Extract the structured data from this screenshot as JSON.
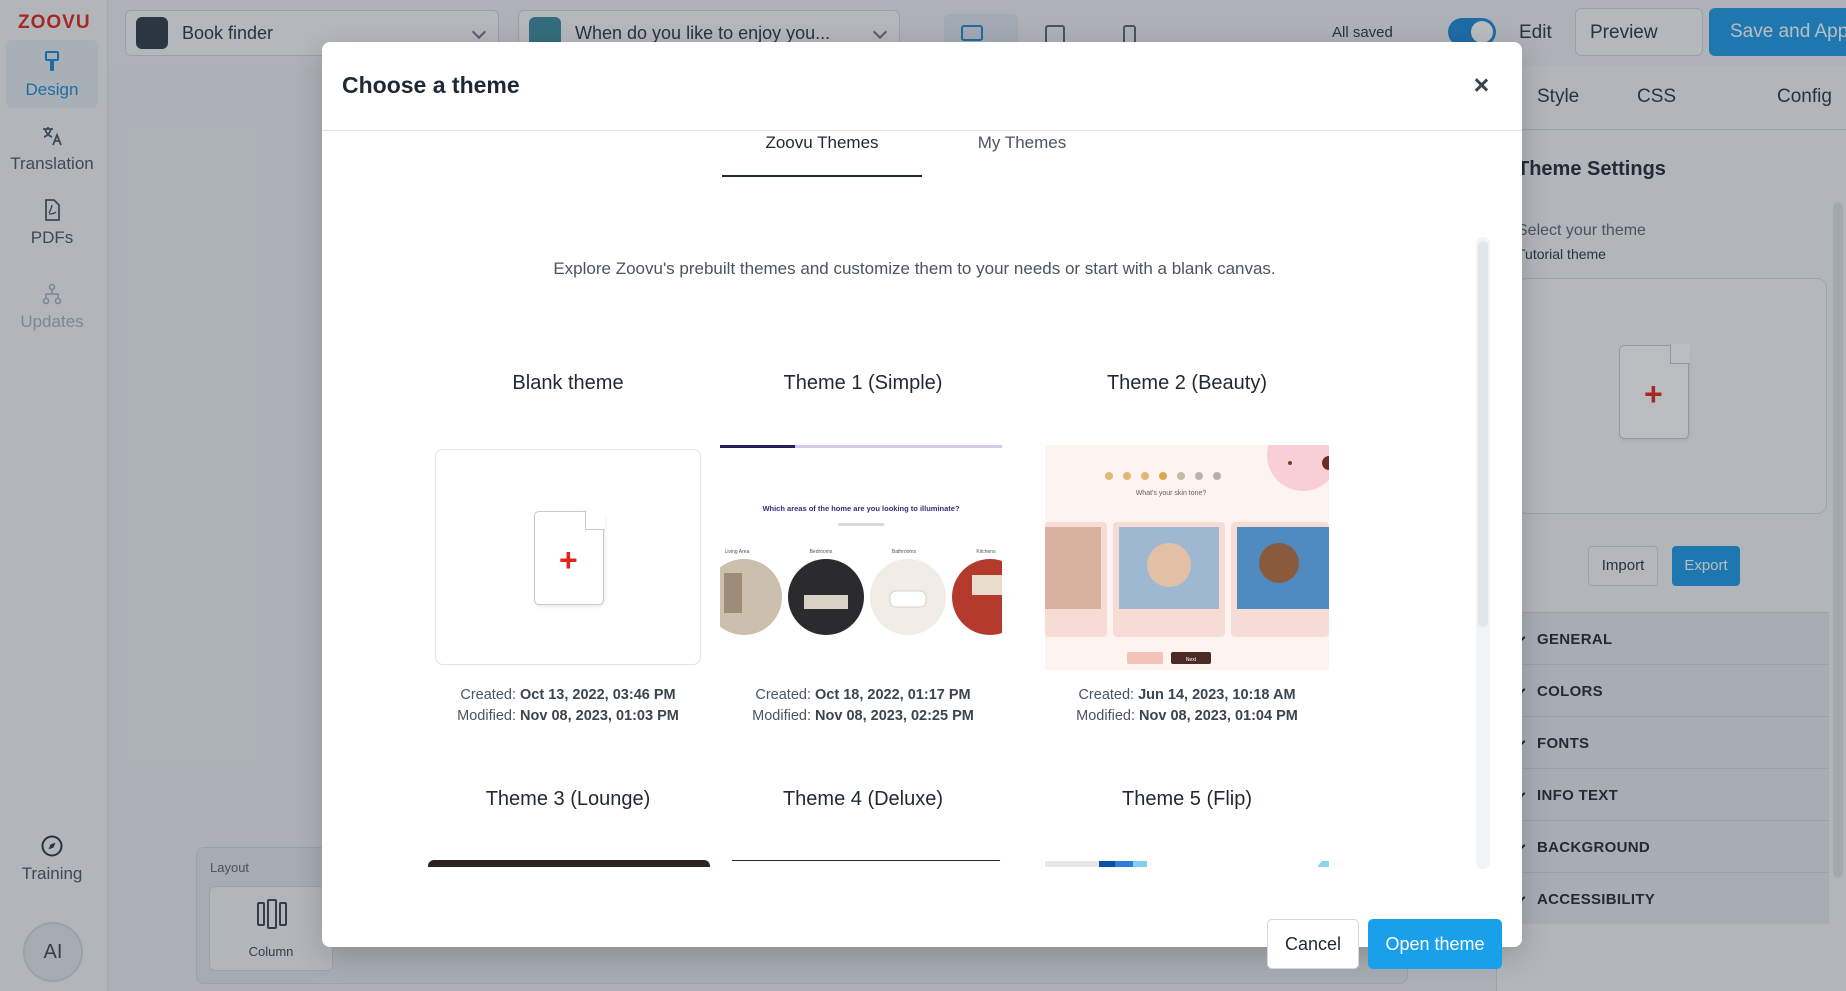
{
  "app": {
    "logo": "ZOOVU",
    "brand_color": "#e1251b",
    "accent_color": "#1a9be6"
  },
  "sidebar": {
    "items": [
      {
        "label": "Design",
        "icon": "paint-brush-icon"
      },
      {
        "label": "Translation",
        "icon": "translate-icon"
      },
      {
        "label": "PDFs",
        "icon": "pdf-icon"
      },
      {
        "label": "Updates",
        "icon": "flow-icon"
      },
      {
        "label": "Training",
        "icon": "compass-icon"
      }
    ],
    "ai_badge": "AI"
  },
  "topbar": {
    "project_select": "Book finder",
    "question_select": "When do you like to enjoy you...",
    "all_saved": "All saved",
    "edit_label": "Edit",
    "preview_label": "Preview",
    "save_apply_label": "Save and Apply"
  },
  "canvas": {
    "layout_label": "Layout",
    "layout_column_label": "Column"
  },
  "right_panel": {
    "tabs": [
      "Style",
      "CSS",
      "Config"
    ],
    "title": "Theme Settings",
    "select_label": "Select your theme",
    "current_theme": "Tutorial theme",
    "import_label": "Import",
    "export_label": "Export",
    "sections": [
      "GENERAL",
      "COLORS",
      "FONTS",
      "INFO TEXT",
      "BACKGROUND",
      "ACCESSIBILITY"
    ]
  },
  "modal": {
    "title": "Choose a theme",
    "tabs": [
      "Zoovu Themes",
      "My Themes"
    ],
    "intro": "Explore Zoovu's prebuilt themes and customize them to your needs or start with a blank canvas.",
    "created_prefix": "Created:",
    "modified_prefix": "Modified:",
    "themes": [
      {
        "name": "Blank theme",
        "created": "Oct 13, 2022, 03:46 PM",
        "modified": "Nov 08, 2023, 01:03 PM"
      },
      {
        "name": "Theme 1 (Simple)",
        "created": "Oct 18, 2022, 01:17 PM",
        "modified": "Nov 08, 2023, 02:25 PM"
      },
      {
        "name": "Theme 2 (Beauty)",
        "created": "Jun 14, 2023, 10:18 AM",
        "modified": "Nov 08, 2023, 01:04 PM"
      },
      {
        "name": "Theme 3 (Lounge)"
      },
      {
        "name": "Theme 4 (Deluxe)"
      },
      {
        "name": "Theme 5 (Flip)"
      }
    ],
    "simple_preview": {
      "question": "Which areas of the home are you looking to illuminate?",
      "options": [
        "Living Area",
        "Bedrooms",
        "Bathrooms",
        "Kitchens"
      ]
    },
    "beauty_preview": {
      "question": "What's your skin tone?",
      "next": "Next"
    },
    "cancel_label": "Cancel",
    "open_label": "Open theme"
  }
}
